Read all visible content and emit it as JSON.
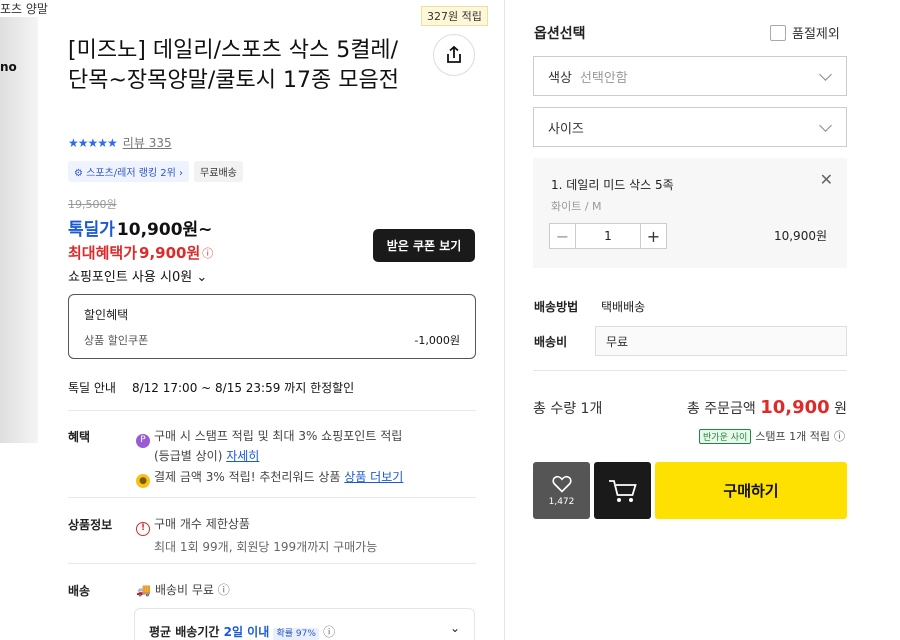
{
  "image_caption": "포츠 양말",
  "image_brand": "no",
  "product": {
    "earn_badge": "327원 적립",
    "title": "[미즈노] 데일리/스포츠 삭스 5켤레/단목~장목양말/쿨토시 17종 모음전",
    "stars": "★★★★★",
    "review_label": "리뷰 335",
    "tag_rank": "스포츠/레저 랭킹 2위",
    "tag_free": "무료배송",
    "original_price": "19,500원",
    "deal_label": "톡딜가",
    "deal_price": "10,900원~",
    "max_benefit_label": "최대혜택가",
    "max_benefit_price": "9,900원",
    "point_use": "쇼핑포인트 사용 시0원",
    "coupon_button": "받은 쿠폰 보기"
  },
  "discount": {
    "heading": "할인혜택",
    "coupon_label": "상품 할인쿠폰",
    "coupon_amount": "-1,000원"
  },
  "special": {
    "label": "톡딜 안내",
    "period": "8/12 17:00 ~ 8/15 23:59 까지 한정할인"
  },
  "benefit": {
    "label": "혜택",
    "line1": "구매 시 스탬프 적립 및 최대 3% 쇼핑포인트 적립",
    "line1b": "(등급별 상이)",
    "line1_link": "자세히",
    "line2": "결제 금액 3% 적립! 추천리워드 상품",
    "line2_link": "상품 더보기"
  },
  "product_info": {
    "label": "상품정보",
    "line1": "구매 개수 제한상품",
    "line2": "최대 1회 99개, 회원당 199개까지 구매가능"
  },
  "shipping_info": {
    "label": "배송",
    "free": "배송비 무료",
    "avg_label": "평균 배송기간",
    "avg_value": "2일 이내",
    "prob": "확률 97%"
  },
  "options": {
    "title": "옵션선택",
    "exclude_soldout": "품절제외",
    "color_label": "색상",
    "color_placeholder": "선택안함",
    "size_label": "사이즈"
  },
  "selected_item": {
    "name": "1. 데일리 미드 삭스 5족",
    "variant": "화이트 / M",
    "quantity": "1",
    "price": "10,900원"
  },
  "delivery": {
    "method_label": "배송방법",
    "method_value": "택배배송",
    "fee_label": "배송비",
    "fee_value": "무료"
  },
  "summary": {
    "total_qty": "총 수량 1개",
    "total_label": "총 주문금액",
    "total_amount": "10,900",
    "currency": "원",
    "stamp_badge": "반가운 사이",
    "stamp_text": "스탬프 1개 적립"
  },
  "actions": {
    "like_count": "1,472",
    "buy": "구매하기"
  },
  "colors": {
    "accent_yellow": "#ffe100",
    "price_red": "#e02a2a",
    "deal_blue": "#1a5ad8"
  }
}
